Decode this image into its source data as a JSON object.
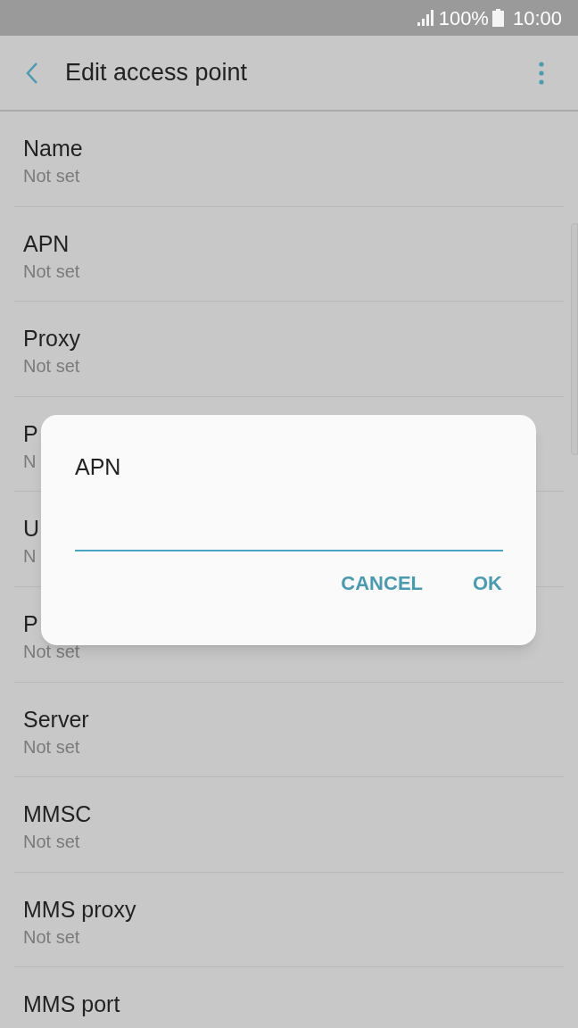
{
  "status_bar": {
    "battery": "100%",
    "time": "10:00"
  },
  "header": {
    "title": "Edit access point"
  },
  "settings": [
    {
      "title": "Name",
      "value": "Not set"
    },
    {
      "title": "APN",
      "value": "Not set"
    },
    {
      "title": "Proxy",
      "value": "Not set"
    },
    {
      "title": "P",
      "value": "N"
    },
    {
      "title": "U",
      "value": "N"
    },
    {
      "title": "P",
      "value": "Not set"
    },
    {
      "title": "Server",
      "value": "Not set"
    },
    {
      "title": "MMSC",
      "value": "Not set"
    },
    {
      "title": "MMS proxy",
      "value": "Not set"
    },
    {
      "title": "MMS port"
    }
  ],
  "dialog": {
    "title": "APN",
    "buttons": [
      "CANCEL",
      "OK"
    ]
  }
}
